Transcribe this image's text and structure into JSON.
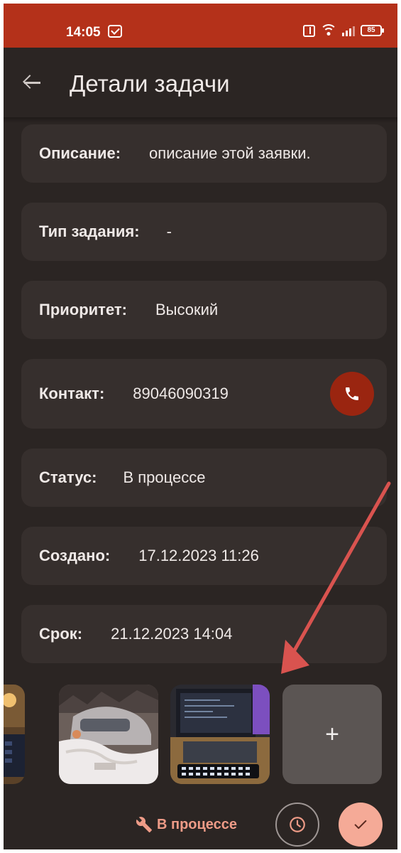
{
  "status_bar": {
    "time": "14:05",
    "battery": "85"
  },
  "header": {
    "title": "Детали задачи"
  },
  "fields": [
    {
      "label": "Описание:",
      "value": "описание этой заявки."
    },
    {
      "label": "Тип задания:",
      "value": "-"
    },
    {
      "label": "Приоритет:",
      "value": "Высокий"
    },
    {
      "label": "Контакт:",
      "value": "89046090319"
    },
    {
      "label": "Статус:",
      "value": "В процессе"
    },
    {
      "label": "Создано:",
      "value": "17.12.2023 11:26"
    },
    {
      "label": "Срок:",
      "value": "21.12.2023 14:04"
    }
  ],
  "photos": {
    "add_label": "+"
  },
  "bottom_bar": {
    "status_label": "В процессе",
    "status_icon": "wrench-icon",
    "history_icon": "clock-icon",
    "done_icon": "check-icon"
  },
  "colors": {
    "status_bar": "#b4311a",
    "background": "#2b2523",
    "card": "#362f2d",
    "call_button": "#9a2510",
    "accent": "#f5aa97",
    "annotation_arrow": "#d9534f"
  }
}
